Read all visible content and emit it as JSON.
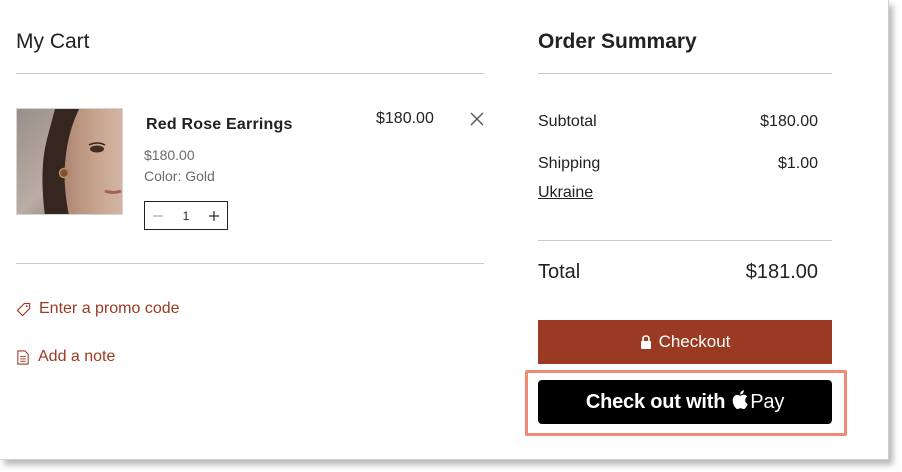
{
  "cart": {
    "title": "My Cart",
    "item": {
      "name": "Red Rose Earrings",
      "unit_price": "$180.00",
      "color": "Color: Gold",
      "quantity": "1",
      "line_total": "$180.00"
    },
    "promo_label": "Enter a promo code",
    "note_label": "Add a note"
  },
  "summary": {
    "title": "Order Summary",
    "subtotal_label": "Subtotal",
    "subtotal_value": "$180.00",
    "shipping_label": "Shipping",
    "shipping_value": "$1.00",
    "shipping_country": "Ukraine",
    "total_label": "Total",
    "total_value": "$181.00",
    "checkout_label": "Checkout",
    "applepay_prefix": "Check out with",
    "applepay_suffix": "Pay"
  },
  "icons": {
    "remove": "close-icon",
    "qty_minus": "minus-icon",
    "qty_plus": "plus-icon",
    "promo": "tag-icon",
    "note": "note-icon",
    "checkout": "lock-icon",
    "applepay": "apple-icon"
  },
  "colors": {
    "accent": "#9a3a22",
    "applepay_bg": "#000000",
    "highlight": "#ee8a75"
  }
}
